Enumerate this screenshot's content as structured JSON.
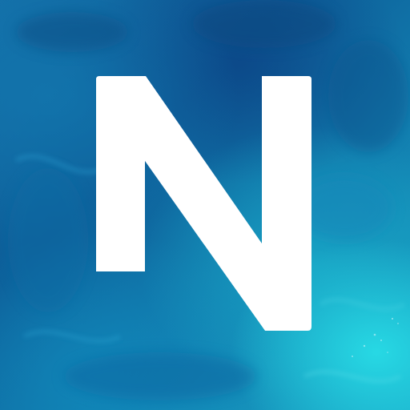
{
  "app_icon": {
    "logo": "N",
    "logo_color": "#ffffff",
    "background_colors": [
      "#0d5d98",
      "#146fa8",
      "#1aa9c8",
      "#28dce6"
    ]
  }
}
